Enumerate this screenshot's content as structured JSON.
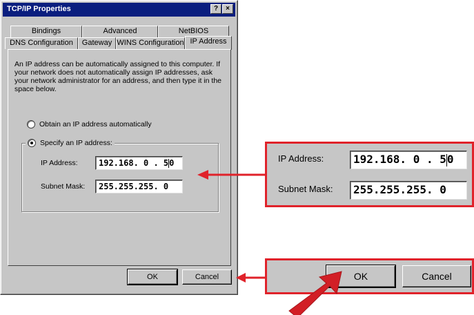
{
  "dialog": {
    "title": "TCP/IP Properties",
    "help_button": "?",
    "close_button": "×",
    "tabs_back": [
      "Bindings",
      "Advanced",
      "NetBIOS"
    ],
    "tabs_front": [
      "DNS Configuration",
      "Gateway",
      "WINS Configuration",
      "IP Address"
    ],
    "active_tab": "IP Address",
    "description": "An IP address can be automatically assigned to this computer. If your network does not automatically assign IP addresses, ask your network administrator for an address, and then type it in the space below.",
    "obtain_auto_label": "Obtain an IP address automatically",
    "specify_label": "Specify an IP address:",
    "selected_option": "specify",
    "ip_label": "IP Address:",
    "ip_value": "192.168. 0 . 5",
    "ip_value_after_caret": "0",
    "subnet_label": "Subnet Mask:",
    "subnet_value": "255.255.255. 0",
    "ok_label": "OK",
    "cancel_label": "Cancel"
  },
  "zoom_fields": {
    "ip_label": "IP Address:",
    "ip_value": "192.168. 0 . 5",
    "ip_value_after_caret": "0",
    "subnet_label": "Subnet Mask:",
    "subnet_value": "255.255.255. 0"
  },
  "zoom_buttons": {
    "ok_label": "OK",
    "cancel_label": "Cancel"
  },
  "colors": {
    "callout": "#e0222a",
    "titlebar": "#0a1e7f",
    "dialog_bg": "#c6c6c6"
  },
  "icons": [
    "help-icon",
    "close-icon",
    "callout-arrow-left",
    "pointer-arrow"
  ]
}
